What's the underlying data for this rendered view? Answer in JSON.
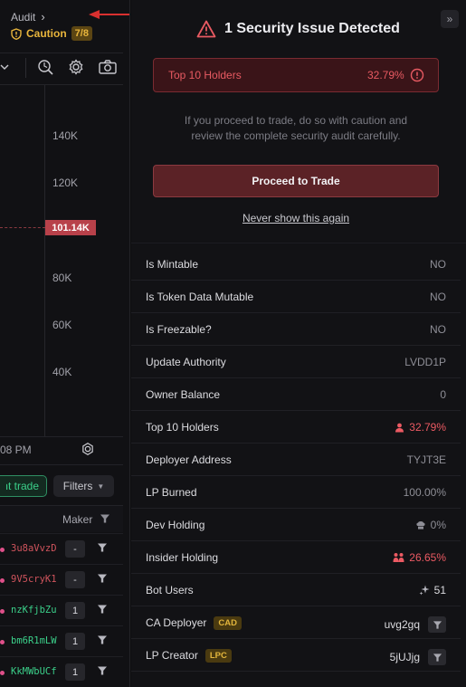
{
  "audit": {
    "label": "Audit",
    "caution_label": "Caution",
    "caution_score": "7/8"
  },
  "chart": {
    "y_labels": [
      "140K",
      "120K",
      "80K",
      "60K",
      "40K"
    ],
    "price_label": "101.14K",
    "time_label": "08 PM"
  },
  "trades": {
    "instant_label": "Instant trade",
    "filters_label": "Filters",
    "maker_header": "Maker",
    "rows": [
      {
        "addr": "3u8aVvzD",
        "count": "-"
      },
      {
        "addr": "9V5cryK1",
        "count": "-"
      },
      {
        "addr": "nzKfjbZu",
        "count": "1"
      },
      {
        "addr": "bm6R1mLW",
        "count": "1"
      },
      {
        "addr": "KkMWbUCf",
        "count": "1"
      }
    ]
  },
  "security": {
    "title": "1 Security Issue Detected",
    "alert_name": "Top 10 Holders",
    "alert_value": "32.79%",
    "warning": "If you proceed to trade, do so with caution and review the complete security audit carefully.",
    "proceed_label": "Proceed to Trade",
    "never_label": "Never show this again",
    "items": [
      {
        "label": "Is Mintable",
        "value": "NO"
      },
      {
        "label": "Is Token Data Mutable",
        "value": "NO"
      },
      {
        "label": "Is Freezable?",
        "value": "NO"
      },
      {
        "label": "Update Authority",
        "value": "LVDD1P"
      },
      {
        "label": "Owner Balance",
        "value": "0"
      },
      {
        "label": "Top 10 Holders",
        "value": "32.79%"
      },
      {
        "label": "Deployer Address",
        "value": "TYJT3E"
      },
      {
        "label": "LP Burned",
        "value": "100.00%"
      },
      {
        "label": "Dev Holding",
        "value": "0%"
      },
      {
        "label": "Insider Holding",
        "value": "26.65%"
      },
      {
        "label": "Bot Users",
        "value": "51"
      },
      {
        "label": "CA Deployer",
        "tag": "CAD",
        "value": "uvg2gq"
      },
      {
        "label": "LP Creator",
        "tag": "LPC",
        "value": "5jUJjg"
      }
    ]
  },
  "colors": {
    "danger": "#e85a62",
    "caution": "#e8b53c",
    "buy": "#3bd08a",
    "sell": "#e0508a"
  }
}
